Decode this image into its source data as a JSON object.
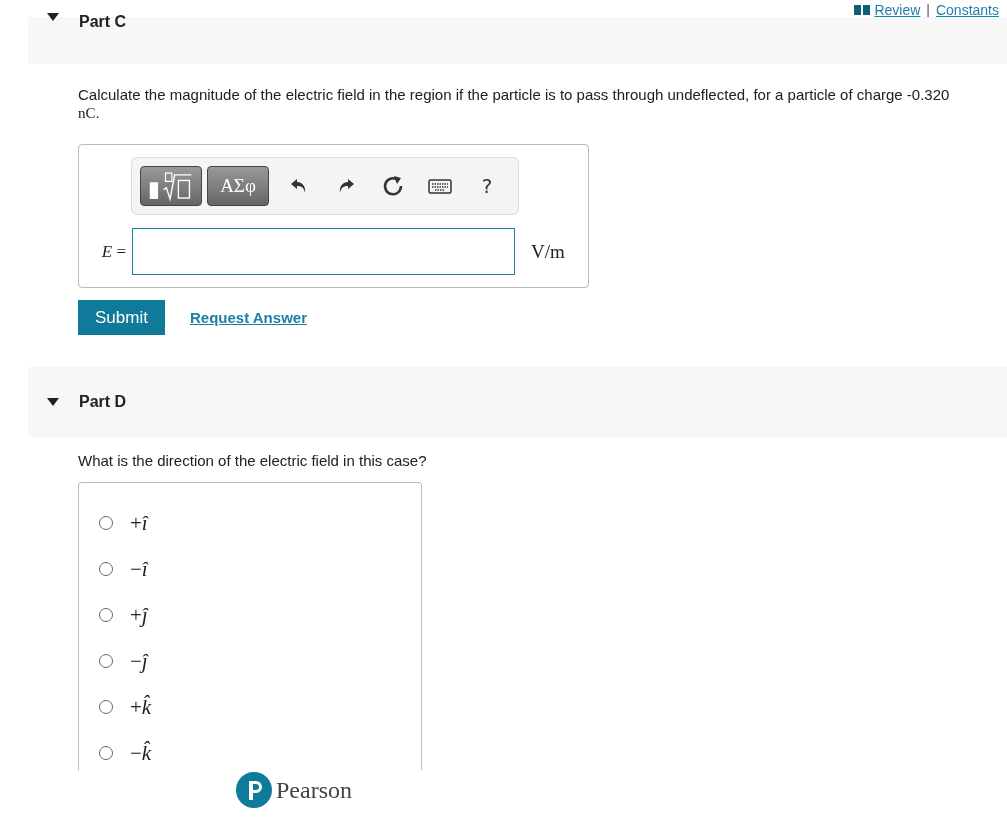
{
  "top_links": [
    {
      "label": "Review",
      "kind": "book"
    },
    {
      "label": "Constants",
      "kind": "plain"
    }
  ],
  "top_links_separator": "|",
  "parts": [
    {
      "title": "Part C",
      "expanded": true,
      "kind": "numeric",
      "question": "Calculate the magnitude of the electric field in the region if the particle is to pass through undeflected, for a particle of charge -0.320 **nC**.",
      "toolbar": [
        {
          "kind": "templates"
        },
        {
          "kind": "text",
          "label": "ΑΣφ"
        },
        {
          "kind": "undo"
        },
        {
          "kind": "redo"
        },
        {
          "kind": "reset"
        },
        {
          "kind": "keyboard"
        },
        {
          "kind": "help",
          "label": "?"
        }
      ],
      "variable": "E",
      "equals": "=",
      "unit": "V/m",
      "submit": "Submit",
      "request": "Request Answer"
    },
    {
      "title": "Part D",
      "expanded": true,
      "kind": "choice",
      "question": "What is the direction of the electric field in this case?",
      "options": [
        {
          "label": "+*î*",
          "selected": false
        },
        {
          "label": "−*î*",
          "selected": false
        },
        {
          "label": "+*ĵ*",
          "selected": false
        },
        {
          "label": "−*ĵ*",
          "selected": false
        },
        {
          "label": "+*k̂*",
          "selected": false
        },
        {
          "label": "−*k̂*",
          "selected": false
        }
      ]
    }
  ],
  "footer": {
    "brand": "Pearson"
  }
}
